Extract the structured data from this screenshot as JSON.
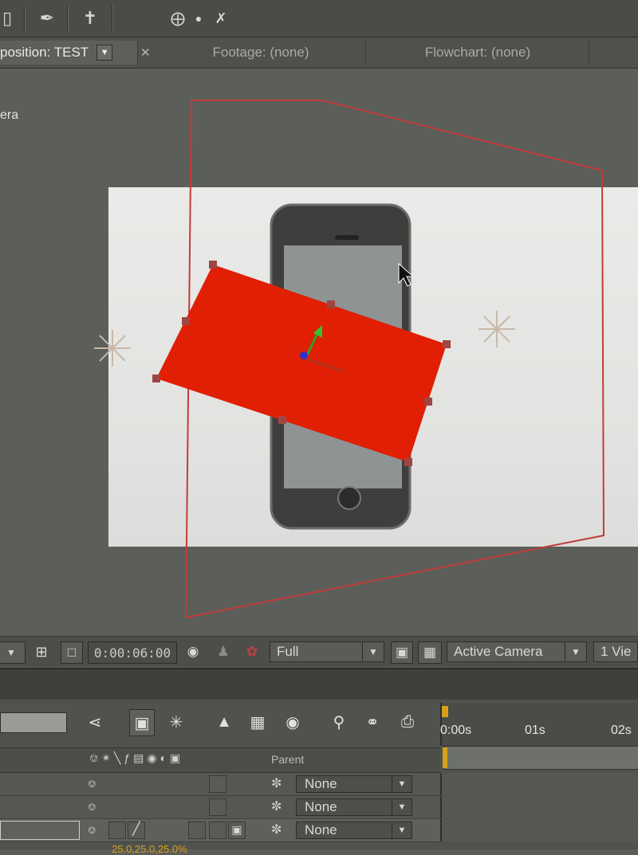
{
  "tabs": {
    "composition": "position: TEST",
    "footage": "Footage: (none)",
    "flowchart": "Flowchart: (none)"
  },
  "viewer": {
    "view_name": "era"
  },
  "viewer_bar": {
    "timecode": "0:00:06:00",
    "resolution": "Full",
    "camera_view": "Active Camera",
    "view_layout": "1 Vie"
  },
  "timeline": {
    "ruler_ticks": [
      "0:00s",
      "01s",
      "02s"
    ],
    "parent_header": "Parent",
    "layers": [
      {
        "parent": "None"
      },
      {
        "parent": "None"
      },
      {
        "parent": "None"
      }
    ],
    "transform_values": "25.0,25.0,25.0%"
  },
  "icons": {
    "toolbar": [
      "eraser-icon",
      "puppet-pin-icon",
      "pin-icon",
      "axis-local-icon",
      "axis-world-icon",
      "axis-view-icon"
    ],
    "viewer_bar": [
      "region-of-interest-icon",
      "transparency-grid-icon",
      "snapshot-icon",
      "show-snapshot-icon",
      "color-channel-icon"
    ],
    "timeline": [
      "comp-flowchart-icon",
      "draft-3d-icon",
      "motion-blur-icon",
      "brainstorm-icon",
      "hide-shy-icon",
      "frame-blending-icon",
      "graph-editor-icon"
    ]
  },
  "colors": {
    "solid_layer": "#e01f05",
    "camera_frame": "#c23c3c",
    "current_time_indicator": "#d8a11a"
  }
}
